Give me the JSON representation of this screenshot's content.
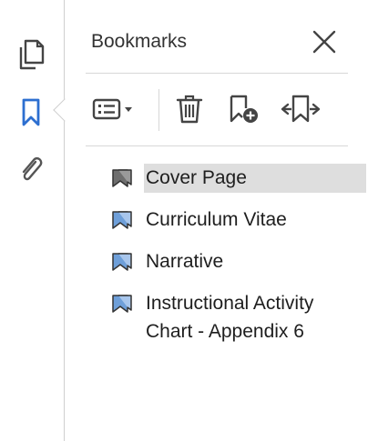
{
  "panel": {
    "title": "Bookmarks"
  },
  "rail": {
    "items": [
      {
        "name": "pages-icon"
      },
      {
        "name": "bookmark-icon"
      },
      {
        "name": "attachment-icon"
      }
    ]
  },
  "toolbar": {
    "items": [
      "options-icon",
      "delete-icon",
      "new-bookmark-icon",
      "expand-bookmark-icon"
    ]
  },
  "bookmarks": [
    {
      "label": "Cover Page",
      "selected": true
    },
    {
      "label": "Curriculum Vitae",
      "selected": false
    },
    {
      "label": "Narrative",
      "selected": false
    },
    {
      "label": "Instructional Activity Chart - Appendix 6",
      "selected": false
    }
  ],
  "colors": {
    "accent": "#2d6fd0",
    "icon": "#4a4a4a",
    "selected_bg": "#dedede",
    "bookmark_blue": "#6e9fd9"
  }
}
